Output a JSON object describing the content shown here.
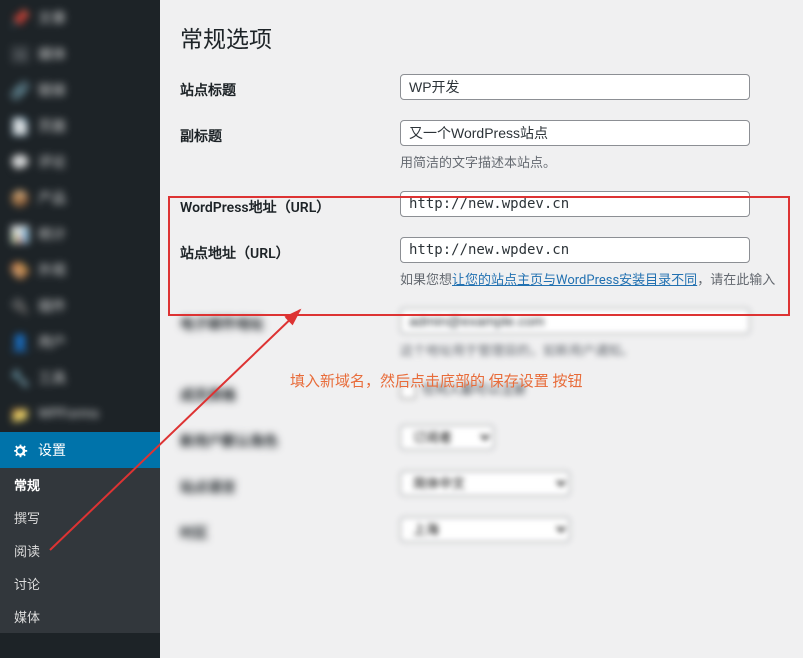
{
  "sidebar": {
    "blurred_top": [
      {
        "icon": "📌",
        "label": "文章"
      },
      {
        "icon": "🖼",
        "label": "媒体"
      },
      {
        "icon": "🔗",
        "label": "链接"
      },
      {
        "icon": "📄",
        "label": "页面"
      },
      {
        "icon": "💬",
        "label": "评论"
      },
      {
        "icon": "📦",
        "label": "产品"
      },
      {
        "icon": "📊",
        "label": "统计"
      },
      {
        "icon": "🎨",
        "label": "外观"
      },
      {
        "icon": "🔌",
        "label": "插件"
      },
      {
        "icon": "👤",
        "label": "用户"
      },
      {
        "icon": "🔧",
        "label": "工具"
      },
      {
        "icon": "📁",
        "label": "WPForms"
      }
    ],
    "active": {
      "icon": "⚙",
      "label": "设置"
    },
    "subs": [
      "常规",
      "撰写",
      "阅读",
      "讨论",
      "媒体"
    ]
  },
  "main": {
    "title": "常规选项",
    "rows": {
      "site_title": {
        "label": "站点标题",
        "value": "WP开发"
      },
      "tagline": {
        "label": "副标题",
        "value": "又一个WordPress站点",
        "desc": "用简洁的文字描述本站点。"
      },
      "wpurl": {
        "label": "WordPress地址（URL）",
        "value": "http://new.wpdev.cn"
      },
      "siteurl": {
        "label": "站点地址（URL）",
        "value": "http://new.wpdev.cn",
        "desc_prefix": "如果您想",
        "link": "让您的站点主页与WordPress安装目录不同",
        "desc_suffix": "，请在此输入"
      },
      "blur1": {
        "label": "电子邮件地址",
        "value": "admin@example.com",
        "desc": "这个地址用于管理目的，如新用户通知。"
      },
      "blur2": {
        "label": "成员资格",
        "cb_label": "任何人都可以注册"
      },
      "blur3": {
        "label": "新用户默认角色",
        "value": "订阅者"
      },
      "blur4": {
        "label": "站点语言",
        "value": "简体中文"
      },
      "blur5": {
        "label": "时区",
        "value": "上海"
      }
    }
  },
  "annotation": "填入新域名，然后点击底部的 保存设置 按钮"
}
